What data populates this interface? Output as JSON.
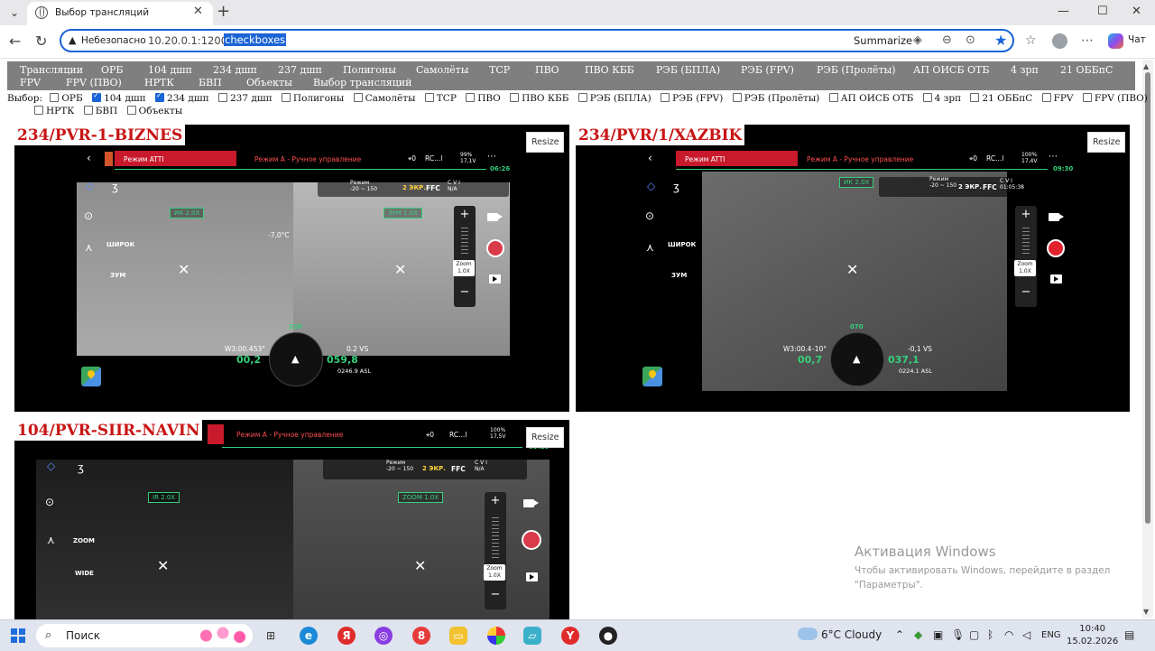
{
  "browser": {
    "tab_title": "Выбор трансляций",
    "new_tab": "+",
    "window_controls": [
      "—",
      "☐",
      "✕"
    ],
    "address": {
      "security_label": "Небезопасно",
      "host": "10.20.0.1:12000/",
      "path": "checkboxes"
    },
    "summarize_label": "Summarize",
    "copilot_label": "Чат"
  },
  "nav": {
    "items": [
      "Трансляции",
      "ОРБ",
      "104 дшп",
      "234 дшп",
      "237 дшп",
      "Полигоны",
      "Самолёты",
      "ТСР",
      "ПВО",
      "ПВО КББ",
      "РЭБ (БПЛА)",
      "РЭБ (FPV)",
      "РЭБ (Пролёты)",
      "АП ОИСБ ОТБ",
      "4 зрп",
      "21 ОББпС",
      "FPV",
      "FPV (ПВО)",
      "НРТК",
      "БВП",
      "Объекты",
      "Выбор трансляций"
    ]
  },
  "selection": {
    "label": "Выбор:",
    "options": [
      {
        "label": "ОРБ",
        "checked": false
      },
      {
        "label": "104 дшп",
        "checked": true
      },
      {
        "label": "234 дшп",
        "checked": true
      },
      {
        "label": "237 дшп",
        "checked": false
      },
      {
        "label": "Полигоны",
        "checked": false
      },
      {
        "label": "Самолёты",
        "checked": false
      },
      {
        "label": "ТСР",
        "checked": false
      },
      {
        "label": "ПВО",
        "checked": false
      },
      {
        "label": "ПВО КББ",
        "checked": false
      },
      {
        "label": "РЭБ (БПЛА)",
        "checked": false
      },
      {
        "label": "РЭБ (FPV)",
        "checked": false
      },
      {
        "label": "РЭБ (Пролёты)",
        "checked": false
      },
      {
        "label": "АП ОИСБ ОТБ",
        "checked": false
      },
      {
        "label": "4 зрп",
        "checked": false
      },
      {
        "label": "21 ОББпС",
        "checked": false
      },
      {
        "label": "FPV",
        "checked": false
      },
      {
        "label": "FPV (ПВО)",
        "checked": false
      },
      {
        "label": "НРТК",
        "checked": false
      },
      {
        "label": "БВП",
        "checked": false
      },
      {
        "label": "Объекты",
        "checked": false
      }
    ]
  },
  "streams": [
    {
      "title": "234/PVR-1-BIZNES",
      "resize_label": "Resize",
      "hud": {
        "mode_atti": "Режим ATTI",
        "mode_manual": "Режим А - Ручное управление",
        "timer": "06:26",
        "battery": "99%\n17,1V",
        "rc": "RC...l",
        "zoom_left": "ИК 2.0X",
        "zoom_right": "ЗУМ 1.0X",
        "temp": "-7,0°C",
        "range_min": "-20",
        "range_max": "150",
        "range_label": "Режим\n-20 ~ 150",
        "ekr": "2 ЭКР.",
        "ffc": "FFC",
        "cvi": "C V I\nN/A",
        "wide_label": "ШИРОК",
        "zoom_label": "ЗУМ",
        "zoom_value": "Zoom\n1.0X",
        "heading": "W3:00.4",
        "tilt": "-53°",
        "speed_h": "00,2",
        "alt": "059,8",
        "vs": "0.2 VS",
        "asl": "0246.9 ASL",
        "heading_top": "220"
      }
    },
    {
      "title": "234/PVR/1/XAZBIK",
      "resize_label": "Resize",
      "hud": {
        "mode_atti": "Режим ATTI",
        "mode_manual": "Режим А - Ручное управление",
        "timer": "09:30",
        "battery": "100%\n17,4V",
        "rc": "RC...l",
        "zoom_left": "ИК 2.0X",
        "range_label": "Режим\n-20 ~ 150",
        "range_min": "-7",
        "range_max": "-3",
        "ekr": "2 ЭКР.",
        "ffc": "FFC",
        "cvi": "C V I\n01:05:38",
        "wide_label": "ШИРОК",
        "zoom_label": "ЗУМ",
        "zoom_value": "Zoom\n1.0X",
        "heading": "W3:00.4",
        "tilt": "-10°",
        "speed_h": "00,7",
        "alt": "037,1",
        "vs": "-0,1 VS",
        "asl": "0224.1 ASL",
        "heading_top": "070"
      }
    },
    {
      "title": "104/PVR-SIIR-NAVIN",
      "resize_label": "Resize",
      "hud": {
        "mode_manual": "Режим А - Ручное управление",
        "timer": "09:10",
        "battery": "100%\n17,5V",
        "rc": "RC...l",
        "zoom_left": "IR 2.0X",
        "zoom_right": "ZOOM 1.0X",
        "range_min": "-5",
        "range_max": "-3",
        "range_label": "Режим\n-20 ~ 150",
        "ekr": "2 ЭКР.",
        "ffc": "FFC",
        "cvi": "C V I\nN/A",
        "zoom_label": "ZOOM",
        "wide_label": "WIDE",
        "zoom_value": "Zoom\n1.0X"
      }
    }
  ],
  "watermark": {
    "title": "Активация Windows",
    "subtitle": "Чтобы активировать Windows, перейдите в раздел \"Параметры\"."
  },
  "taskbar": {
    "search_label": "Поиск",
    "weather": "6°C  Cloudy",
    "language": "ENG",
    "time": "10:40",
    "date": "15.02.2026"
  }
}
